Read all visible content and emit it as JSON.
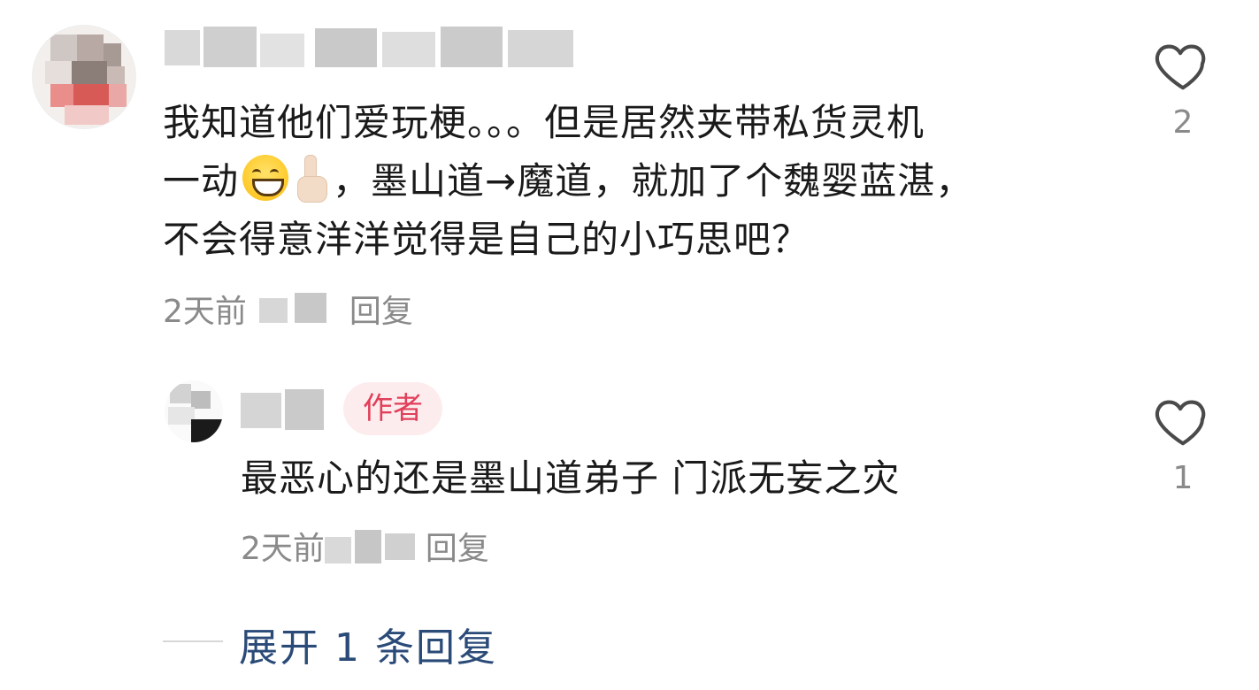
{
  "comments": [
    {
      "text_line1": "我知道他们爱玩梗。。。但是居然夹带私货灵机",
      "text_line2_a": "一动",
      "text_line2_b": "，墨山道→魔道，就加了个魏婴蓝湛，",
      "text_line3": "不会得意洋洋觉得是自己的小巧思吧？",
      "emojis": [
        "grinning-face-emoji",
        "pointing-up-emoji"
      ],
      "time": "2天前",
      "reply_label": "回复",
      "likes": "2"
    }
  ],
  "reply": {
    "badge": "作者",
    "text": "最恶心的还是墨山道弟子 门派无妄之灾",
    "time": "2天前",
    "reply_label": "回复",
    "likes": "1"
  },
  "expand": {
    "label": "展开 1 条回复"
  },
  "colors": {
    "text": "#1a1a1a",
    "meta": "#8a8a8a",
    "badge_bg": "#fdecee",
    "badge_text": "#e0405a",
    "expand_text": "#2a4a78"
  }
}
